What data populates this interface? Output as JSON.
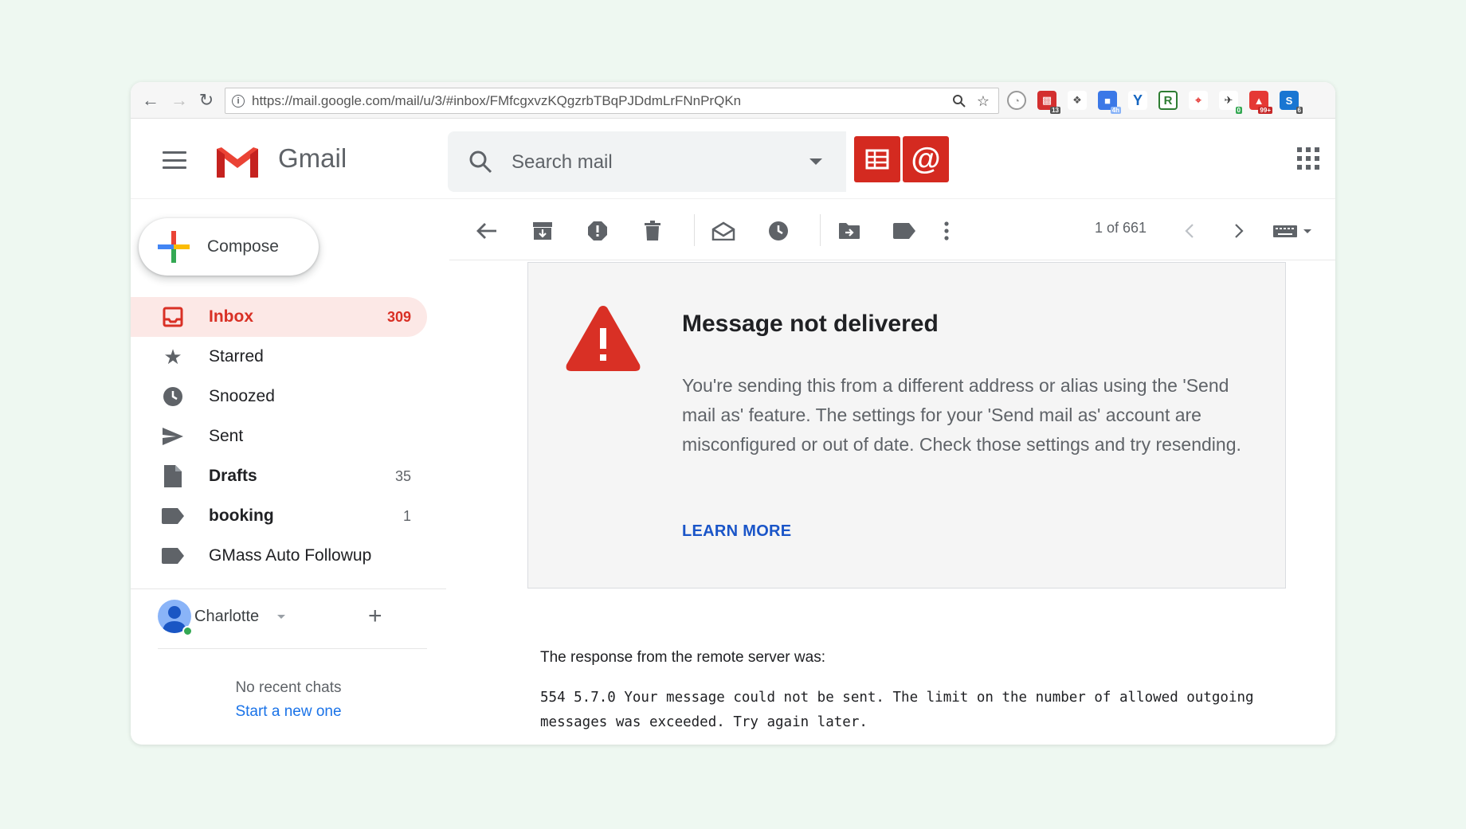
{
  "browser": {
    "url": "https://mail.google.com/mail/u/3/#inbox/FMfcgxvzKQgzrbTBqPJDdmLrFNnPrQKn",
    "extensions": [
      {
        "name": "extension-icon-1",
        "badge": ""
      },
      {
        "name": "extension-icon-2",
        "badge": "13"
      },
      {
        "name": "evernote-icon",
        "badge": ""
      },
      {
        "name": "extension-icon-4",
        "badge": "4h"
      },
      {
        "name": "y-icon",
        "badge": ""
      },
      {
        "name": "r-icon",
        "badge": ""
      },
      {
        "name": "extension-icon-7",
        "badge": ""
      },
      {
        "name": "extension-icon-8",
        "badge": "0"
      },
      {
        "name": "extension-icon-9",
        "badge": "99+"
      },
      {
        "name": "extension-icon-10",
        "badge": "6"
      }
    ]
  },
  "header": {
    "app_name": "Gmail",
    "search_placeholder": "Search mail"
  },
  "sidebar": {
    "compose_label": "Compose",
    "items": [
      {
        "label": "Inbox",
        "count": "309",
        "icon": "inbox-icon"
      },
      {
        "label": "Starred",
        "count": "",
        "icon": "star-icon"
      },
      {
        "label": "Snoozed",
        "count": "",
        "icon": "clock-icon"
      },
      {
        "label": "Sent",
        "count": "",
        "icon": "send-icon"
      },
      {
        "label": "Drafts",
        "count": "35",
        "icon": "draft-icon"
      },
      {
        "label": "booking",
        "count": "1",
        "icon": "label-icon"
      },
      {
        "label": "GMass Auto Followup",
        "count": "",
        "icon": "label-icon"
      }
    ],
    "user_name": "Charlotte",
    "no_chats": "No recent chats",
    "start_new": "Start a new one"
  },
  "toolbar": {
    "pager": "1 of 661"
  },
  "message": {
    "title": "Message not delivered",
    "body": "You're sending this from a different address or alias using the 'Send mail as' feature. The settings for your 'Send mail as' account are misconfigured or out of date. Check those settings and try resending.",
    "learn_more": "LEARN MORE",
    "response_intro": "The response from the remote server was:",
    "response_code": "554 5.7.0 Your message could not be sent. The limit on the number of allowed outgoing messages was exceeded. Try again later."
  },
  "colors": {
    "accent_red": "#d93025",
    "link_blue": "#1a73e8",
    "page_bg": "#eef8f1"
  }
}
